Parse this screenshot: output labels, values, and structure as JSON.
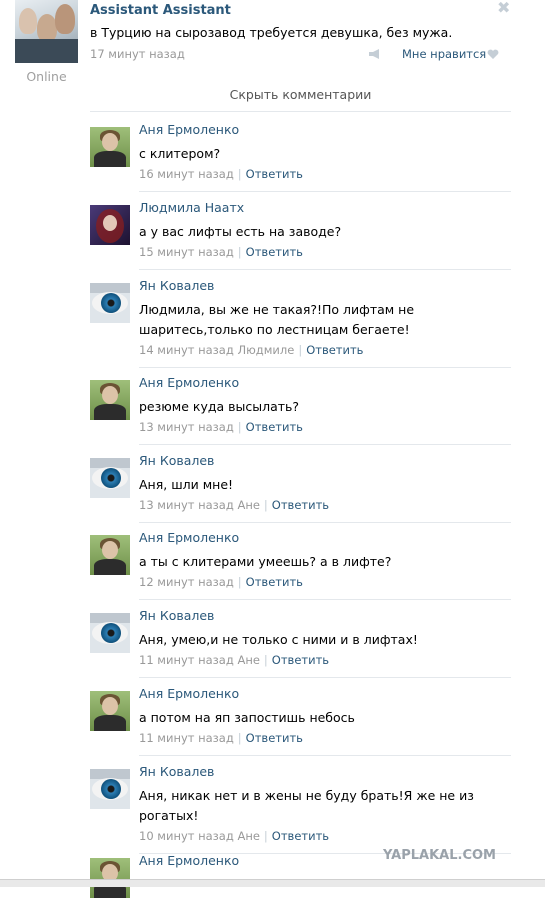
{
  "post": {
    "author": "Assistant Assistant",
    "status": "Online",
    "text": "в Турцию на сырозавод требуется девушка, без мужа.",
    "time": "17 минут назад",
    "like_label": "Мне нравится",
    "close_icon": "close-icon",
    "share_icon": "megaphone-icon",
    "like_icon": "heart-icon"
  },
  "hide_comments": "Скрыть комментарии",
  "reply_label": "Ответить",
  "watermark": "YAPLAKAL.COM",
  "comments": [
    {
      "author": "Аня Ермоленко",
      "avatar": "anya",
      "text": "с клитером?",
      "time": "16 минут назад",
      "reply_to": ""
    },
    {
      "author": "Людмила Наатх",
      "avatar": "lyudmila",
      "text": "а у вас лифты есть на заводе?",
      "time": "15 минут назад",
      "reply_to": ""
    },
    {
      "author": "Ян Ковалев",
      "avatar": "yan",
      "text": "Людмила, вы же не такая?!По лифтам не шаритесь,только по лестницам бегаете!",
      "time": "14 минут назад",
      "reply_to": "Людмиле"
    },
    {
      "author": "Аня Ермоленко",
      "avatar": "anya",
      "text": "резюме куда высылать?",
      "time": "13 минут назад",
      "reply_to": ""
    },
    {
      "author": "Ян Ковалев",
      "avatar": "yan",
      "text": "Аня, шли мне!",
      "time": "13 минут назад",
      "reply_to": "Ане"
    },
    {
      "author": "Аня Ермоленко",
      "avatar": "anya",
      "text": "а ты с клитерами умеешь? а в лифте?",
      "time": "12 минут назад",
      "reply_to": ""
    },
    {
      "author": "Ян Ковалев",
      "avatar": "yan",
      "text": "Аня, умею,и не только с ними и в лифтах!",
      "time": "11 минут назад",
      "reply_to": "Ане"
    },
    {
      "author": "Аня Ермоленко",
      "avatar": "anya",
      "text": "а потом на яп запостишь небось",
      "time": "11 минут назад",
      "reply_to": ""
    },
    {
      "author": "Ян Ковалев",
      "avatar": "yan",
      "text": "Аня, никак нет и в жены не буду брать!Я же не из рогатых!",
      "time": "10 минут назад",
      "reply_to": "Ане"
    },
    {
      "author": "Аня Ермоленко",
      "avatar": "anya",
      "text": "",
      "time": "",
      "reply_to": ""
    }
  ]
}
